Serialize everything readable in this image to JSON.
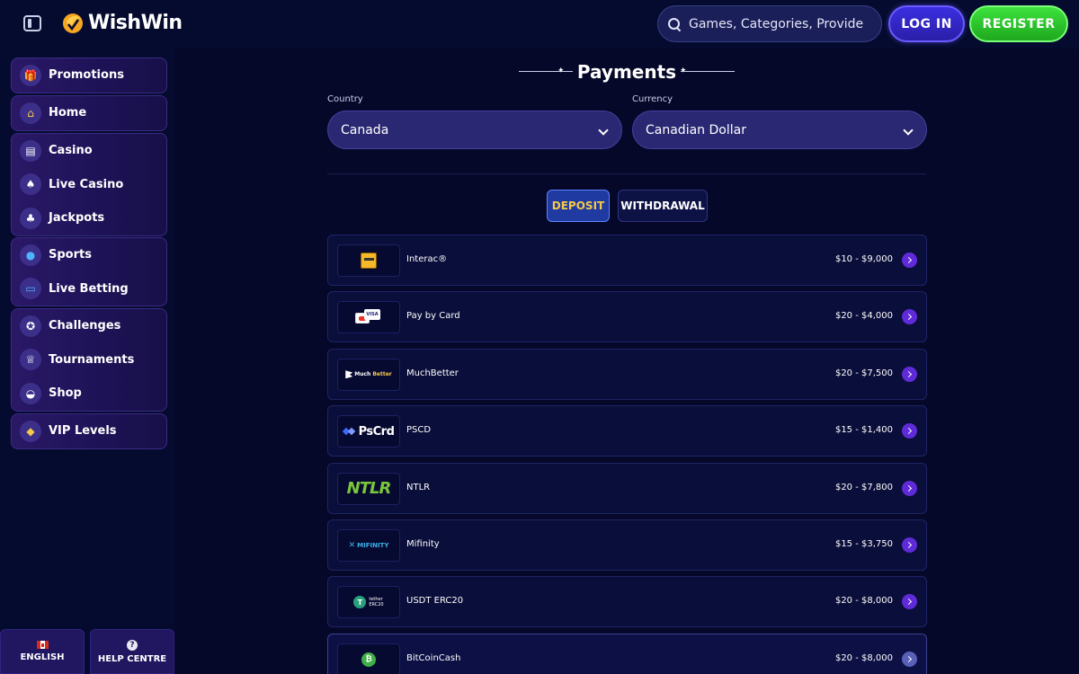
{
  "header": {
    "brand": "WishWin",
    "search_placeholder": "Games, Categories, Providers",
    "login_label": "LOG IN",
    "register_label": "REGISTER"
  },
  "sidebar": {
    "groups": [
      [
        {
          "label": "Promotions",
          "icon": "gift-icon"
        }
      ],
      [
        {
          "label": "Home",
          "icon": "home-icon"
        }
      ],
      [
        {
          "label": "Casino",
          "icon": "slot-machine-icon"
        },
        {
          "label": "Live Casino",
          "icon": "playing-card-icon"
        },
        {
          "label": "Jackpots",
          "icon": "clover-icon"
        }
      ],
      [
        {
          "label": "Sports",
          "icon": "ball-icon"
        },
        {
          "label": "Live Betting",
          "icon": "live-tv-icon"
        }
      ],
      [
        {
          "label": "Challenges",
          "icon": "medal-icon"
        },
        {
          "label": "Tournaments",
          "icon": "trophy-icon"
        },
        {
          "label": "Shop",
          "icon": "basket-icon"
        }
      ],
      [
        {
          "label": "VIP Levels",
          "icon": "diamond-icon"
        }
      ]
    ],
    "language_label": "ENGLISH",
    "help_label": "HELP CENTRE"
  },
  "main": {
    "title": "Payments",
    "country_label": "Country",
    "country_value": "Canada",
    "currency_label": "Currency",
    "currency_value": "Canadian Dollar",
    "tabs": {
      "deposit": "DEPOSIT",
      "withdrawal": "WITHDRAWAL"
    },
    "methods": [
      {
        "name": "Interac®",
        "range": "$10 - $9,000"
      },
      {
        "name": "Pay by Card",
        "range": "$20 - $4,000",
        "logo_text": "VISA"
      },
      {
        "name": "MuchBetter",
        "range": "$20 - $7,500",
        "logo_text_a": "Much",
        "logo_text_b": "Better"
      },
      {
        "name": "PSCD",
        "range": "$15 - $1,400",
        "logo_text": "PsCrd"
      },
      {
        "name": "NTLR",
        "range": "$20 - $7,800",
        "logo_text": "NTLR"
      },
      {
        "name": "Mifinity",
        "range": "$15 - $3,750",
        "logo_text": "MIFINITY"
      },
      {
        "name": "USDT ERC20",
        "range": "$20 - $8,000",
        "logo_text_a": "tether",
        "logo_text_b": "ERC20"
      },
      {
        "name": "BitCoinCash",
        "range": "$20 - $8,000"
      }
    ]
  },
  "colors": {
    "background": "#050b2e",
    "accent_purple": "#5f2ad8",
    "register_green": "#2ec82e",
    "deposit_text": "#f5c94a"
  }
}
